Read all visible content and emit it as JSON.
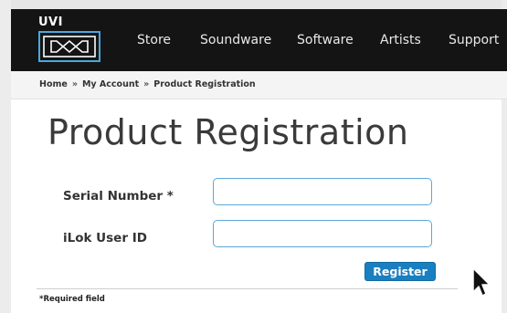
{
  "brand": {
    "logo_text": "UVI"
  },
  "nav": {
    "items": [
      {
        "label": "Store"
      },
      {
        "label": "Soundware"
      },
      {
        "label": "Software"
      },
      {
        "label": "Artists"
      },
      {
        "label": "Support"
      }
    ]
  },
  "breadcrumb": {
    "items": [
      {
        "label": "Home"
      },
      {
        "label": "My Account"
      },
      {
        "label": "Product Registration"
      }
    ],
    "separator": "»"
  },
  "page": {
    "title": "Product Registration"
  },
  "form": {
    "serial": {
      "label": "Serial Number *",
      "value": ""
    },
    "ilok": {
      "label": "iLok User ID",
      "value": ""
    },
    "submit_label": "Register",
    "required_note": "*Required field"
  },
  "colors": {
    "navbar": "#141414",
    "accent": "#1a7fc0",
    "input_border": "#5aa7d8"
  }
}
